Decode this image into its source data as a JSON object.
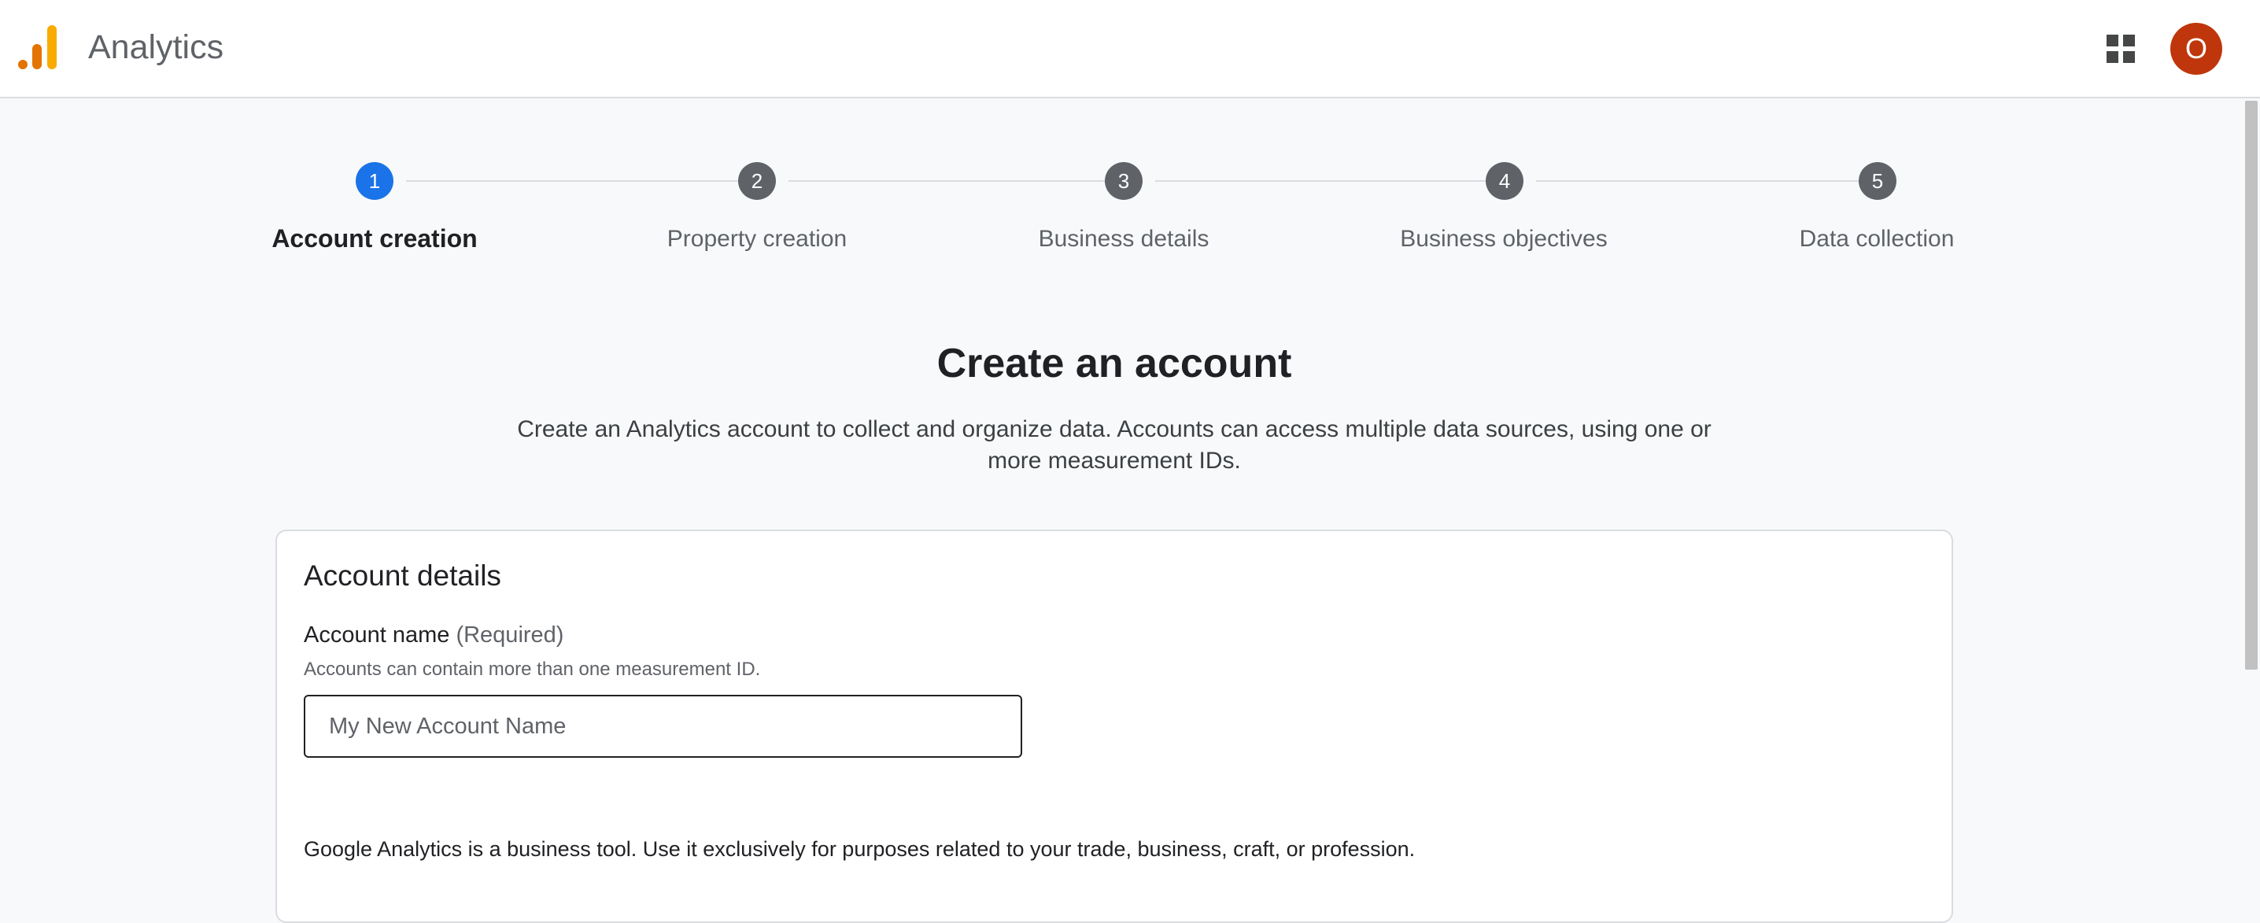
{
  "header": {
    "app_title": "Analytics",
    "logo_icon": "analytics-logo-icon",
    "apps_icon": "apps-grid-icon",
    "avatar_initial": "O",
    "avatar_color": "#bf360c"
  },
  "stepper": {
    "active_color": "#1a73e8",
    "steps": [
      {
        "number": "1",
        "label": "Account creation",
        "active": true
      },
      {
        "number": "2",
        "label": "Property creation",
        "active": false
      },
      {
        "number": "3",
        "label": "Business details",
        "active": false
      },
      {
        "number": "4",
        "label": "Business objectives",
        "active": false
      },
      {
        "number": "5",
        "label": "Data collection",
        "active": false
      }
    ]
  },
  "main": {
    "heading": "Create an account",
    "description": "Create an Analytics account to collect and organize data. Accounts can access multiple data sources, using one or more measurement IDs."
  },
  "account_details": {
    "title": "Account details",
    "name_label": "Account name",
    "name_required": "(Required)",
    "name_hint": "Accounts can contain more than one measurement ID.",
    "name_placeholder": "My New Account Name",
    "name_value": "",
    "disclaimer": "Google Analytics is a business tool. Use it exclusively for purposes related to your trade, business, craft, or profession."
  }
}
